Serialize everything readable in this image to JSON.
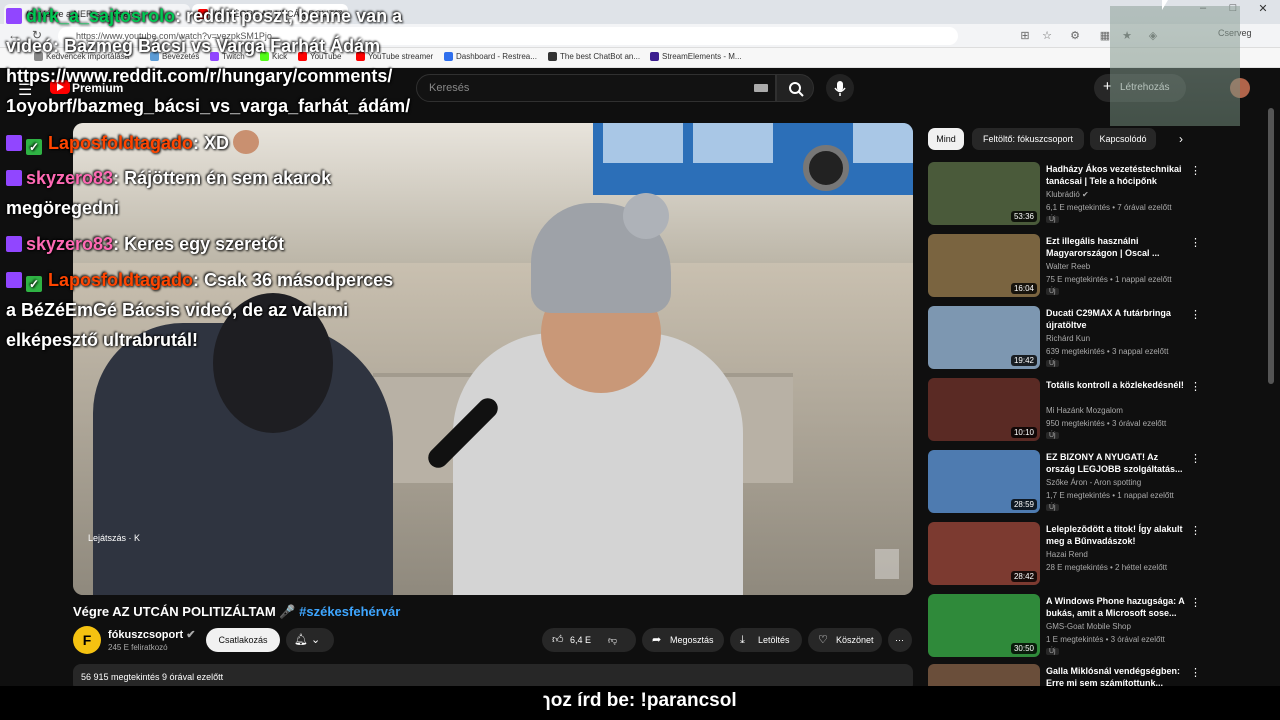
{
  "tabs": [
    {
      "label": "(1) Végre a NER-s ... Cseh...",
      "color": "#ff0000"
    },
    {
      "label": "(9) VÉGRE AZ UTCÁN POLITIZ...",
      "color": "#ff0000"
    }
  ],
  "browser": {
    "url": "https://www.youtube.com/watch?v=vezpkSM1Pjo",
    "profile_label": "Cserveg"
  },
  "bookmarks": [
    {
      "label": "Kedvencek importálása",
      "color": "#888888"
    },
    {
      "label": "Bevezetés",
      "color": "#5b9bd5"
    },
    {
      "label": "Twitch",
      "color": "#9146ff"
    },
    {
      "label": "Kick",
      "color": "#53fc18"
    },
    {
      "label": "YouTube",
      "color": "#ff0000"
    },
    {
      "label": "YouTube streamer",
      "color": "#ff0000"
    },
    {
      "label": "Dashboard - Restrea...",
      "color": "#2f6fed"
    },
    {
      "label": "The best ChatBot an...",
      "color": "#333333"
    },
    {
      "label": "StreamElements - M...",
      "color": "#3b1d8f"
    }
  ],
  "youtube": {
    "logo_label": "Premium",
    "search_placeholder": "Keresés",
    "create_label": "Létrehozás",
    "video": {
      "title": "Végre AZ UTCÁN POLITIZÁLTAM 🎤",
      "hashtag": "#székesfehérvár",
      "playing_label": "Lejátszás · K",
      "channel_initial": "F",
      "channel_name": "fókuszcsoport",
      "subscribers": "245 E feliratkozó",
      "subscribe_label": "Csatlakozás",
      "likes": "6,4 E",
      "share_label": "Megosztás",
      "download_label": "Letöltés",
      "thanks_label": "Köszönet",
      "description": "56 915 megtekintés  9 órával ezelőtt"
    },
    "chips": [
      {
        "label": "Mind",
        "active": true
      },
      {
        "label": "Feltöltő: fókuszcsoport",
        "active": false
      },
      {
        "label": "Kapcsolódó",
        "active": false
      }
    ],
    "recommendations": [
      {
        "title": "Hadházy Ákos vezetéstechnikai tanácsai | Tele a hócipőnk",
        "channel": "Klubrádió ✔",
        "meta": "6,1 E megtekintés • 7 órával ezelőtt",
        "badge": "Új",
        "duration": "53:36",
        "thumb": "#4a5a3a"
      },
      {
        "title": "Ezt illegális használni Magyarországon | Oscal ...",
        "channel": "Walter Reeb",
        "meta": "75 E megtekintés • 1 nappal ezelőtt",
        "badge": "Új",
        "duration": "16:04",
        "thumb": "#7a6440"
      },
      {
        "title": "Ducati C29MAX  A futárbringa újratöltve",
        "channel": "Richárd Kun",
        "meta": "639 megtekintés • 3 nappal ezelőtt",
        "badge": "Új",
        "duration": "19:42",
        "thumb": "#7d97b1"
      },
      {
        "title": "Totális kontroll a közlekedésnél!",
        "channel": "Mi Hazánk Mozgalom",
        "meta": "950 megtekintés • 3 órával ezelőtt",
        "badge": "Új",
        "duration": "10:10",
        "thumb": "#5a2a24"
      },
      {
        "title": "EZ BIZONY A NYUGAT! Az ország LEGJOBB szolgáltatás...",
        "channel": "Szőke Áron - Aron spotting",
        "meta": "1,7 E megtekintés • 1 nappal ezelőtt",
        "badge": "Új",
        "duration": "28:59",
        "thumb": "#4e7bb0"
      },
      {
        "title": "Leleplezõdött a titok! Így alakult meg a Bűnvadászok!",
        "channel": "Hazai Rend",
        "meta": "28 E megtekintés • 2 héttel ezelőtt",
        "badge": "",
        "duration": "28:42",
        "thumb": "#7c3a30"
      },
      {
        "title": "A Windows Phone hazugsága: A bukás, amit a Microsoft sose...",
        "channel": "GMS-Goat Mobile Shop",
        "meta": "1 E megtekintés • 3 órával ezelőtt",
        "badge": "Új",
        "duration": "30:50",
        "thumb": "#2f8a3a"
      },
      {
        "title": "Galla Miklósnál vendégségben: Erre mi sem számítottunk...",
        "channel": "",
        "meta": "",
        "badge": "",
        "duration": "",
        "thumb": "#6a4e3a"
      }
    ]
  },
  "overlay": {
    "reddit_user": "dirk_a_sajtosrolo",
    "reddit_text": ": reddit poszt, benne van a",
    "reddit_line2": "videó: Bazmeg Bácsi vs Varga Farhát Ádám",
    "reddit_url1": "https://www.reddit.com/r/hungary/comments/",
    "reddit_url2": "1oyobrf/bazmeg_bácsi_vs_varga_farhát_ádám/",
    "messages": [
      {
        "user": "Laposfoldtagado",
        "text": ": XD"
      },
      {
        "user": "skyzero83",
        "text": ": Rájöttem én sem akarok"
      },
      {
        "user": "",
        "text": "megöregedni"
      },
      {
        "user": "skyzero83",
        "text": ": Keres egy szeretőt"
      },
      {
        "user": "Laposfoldtagado",
        "text": ": Csak 36 másodperces"
      },
      {
        "user": "",
        "text": "a BéZéEmGé Bácsis videó, de az valami"
      },
      {
        "user": "",
        "text": "elképesztő ultrabrutál!"
      }
    ],
    "bottom_text": "ɿoz írd be: !parancsol",
    "colors": {
      "laposfold": "#ff4500",
      "skyzero": "#ff69b4",
      "dirk": "#00c853"
    }
  }
}
